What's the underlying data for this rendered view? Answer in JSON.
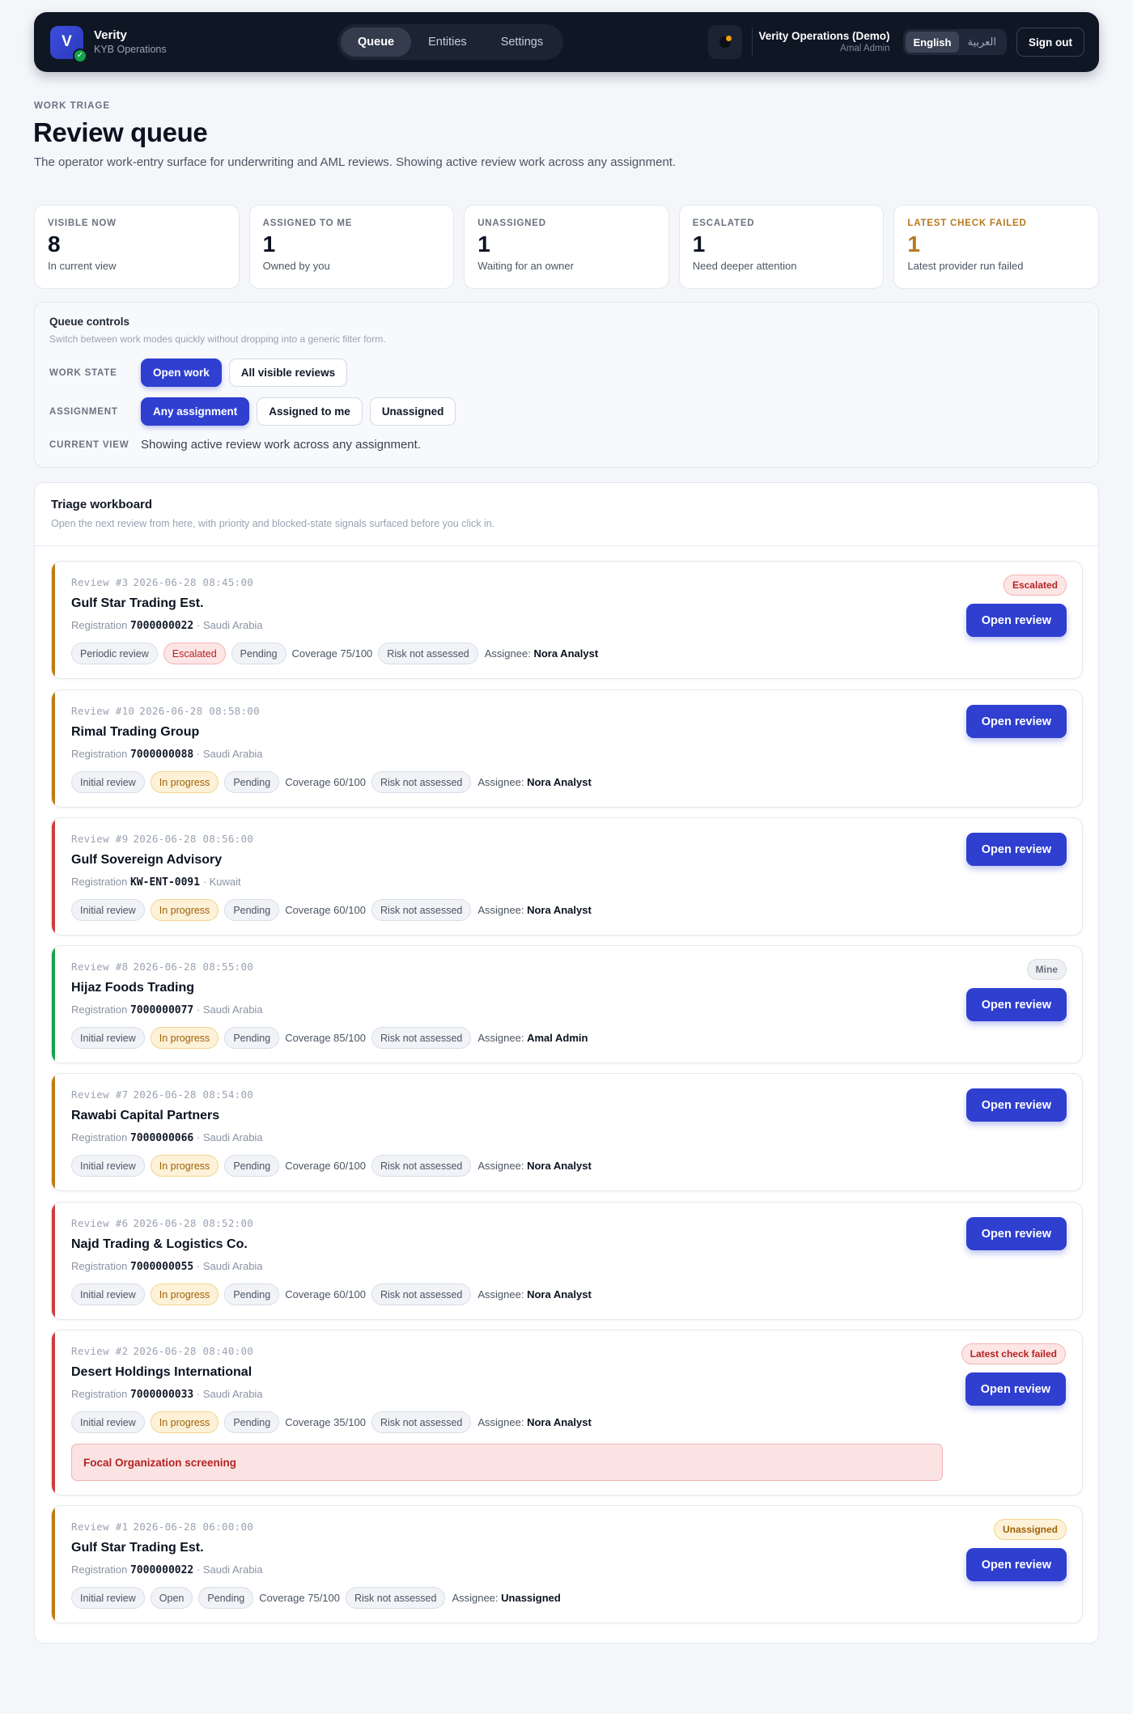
{
  "app": {
    "name": "Verity",
    "subtitle": "KYB Operations",
    "logo_letter": "V"
  },
  "nav": {
    "tabs": [
      {
        "label": "Queue",
        "active": true
      },
      {
        "label": "Entities",
        "active": false
      },
      {
        "label": "Settings",
        "active": false
      }
    ]
  },
  "account": {
    "org": "Verity Operations (Demo)",
    "user": "Amal Admin",
    "languages": [
      "English",
      "العربية"
    ],
    "active_language": "English",
    "signout_label": "Sign out"
  },
  "page": {
    "eyebrow": "WORK TRIAGE",
    "title": "Review queue",
    "description": "The operator work-entry surface for underwriting and AML reviews. Showing active review work across any assignment."
  },
  "stats": [
    {
      "label": "VISIBLE NOW",
      "value": "8",
      "note": "In current view"
    },
    {
      "label": "ASSIGNED TO ME",
      "value": "1",
      "note": "Owned by you"
    },
    {
      "label": "UNASSIGNED",
      "value": "1",
      "note": "Waiting for an owner"
    },
    {
      "label": "ESCALATED",
      "value": "1",
      "note": "Need deeper attention"
    },
    {
      "label": "LATEST CHECK FAILED",
      "value": "1",
      "note": "Latest provider run failed"
    }
  ],
  "controls": {
    "title": "Queue controls",
    "subtitle": "Switch between work modes quickly without dropping into a generic filter form.",
    "work_state_label": "WORK STATE",
    "work_state_options": [
      "Open work",
      "All visible reviews"
    ],
    "assignment_label": "ASSIGNMENT",
    "assignment_options": [
      "Any assignment",
      "Assigned to me",
      "Unassigned"
    ],
    "current_view_label": "CURRENT VIEW",
    "current_view": "Showing active review work across any assignment."
  },
  "board": {
    "title": "Triage workboard",
    "subtitle": "Open the next review from here, with priority and blocked-state signals surfaced before you click in.",
    "open_label": "Open review",
    "registration_label": "Registration",
    "assignee_label": "Assignee:",
    "reviews": [
      {
        "id": "Review #3",
        "time": "2026-06-28 08:45:00",
        "name": "Gulf Star Trading Est.",
        "reg": "7000000022",
        "country": "Saudi Arabia",
        "type": "Periodic review",
        "stage": "Escalated",
        "decision": "Pending",
        "coverage": "Coverage 75/100",
        "risk": "Risk not assessed",
        "assignee": "Nora Analyst",
        "badge": "Escalated",
        "accent": "#c27a12"
      },
      {
        "id": "Review #10",
        "time": "2026-06-28 08:58:00",
        "name": "Rimal Trading Group",
        "reg": "7000000088",
        "country": "Saudi Arabia",
        "type": "Initial review",
        "stage": "In progress",
        "decision": "Pending",
        "coverage": "Coverage 60/100",
        "risk": "Risk not assessed",
        "assignee": "Nora Analyst",
        "badge": "",
        "accent": "#c27a12"
      },
      {
        "id": "Review #9",
        "time": "2026-06-28 08:56:00",
        "name": "Gulf Sovereign Advisory",
        "reg": "KW-ENT-0091",
        "country": "Kuwait",
        "type": "Initial review",
        "stage": "In progress",
        "decision": "Pending",
        "coverage": "Coverage 60/100",
        "risk": "Risk not assessed",
        "assignee": "Nora Analyst",
        "badge": "",
        "accent": "#d23b3b"
      },
      {
        "id": "Review #8",
        "time": "2026-06-28 08:55:00",
        "name": "Hijaz Foods Trading",
        "reg": "7000000077",
        "country": "Saudi Arabia",
        "type": "Initial review",
        "stage": "In progress",
        "decision": "Pending",
        "coverage": "Coverage 85/100",
        "risk": "Risk not assessed",
        "assignee": "Amal Admin",
        "badge": "Mine",
        "accent": "#16a34a"
      },
      {
        "id": "Review #7",
        "time": "2026-06-28 08:54:00",
        "name": "Rawabi Capital Partners",
        "reg": "7000000066",
        "country": "Saudi Arabia",
        "type": "Initial review",
        "stage": "In progress",
        "decision": "Pending",
        "coverage": "Coverage 60/100",
        "risk": "Risk not assessed",
        "assignee": "Nora Analyst",
        "badge": "",
        "accent": "#c27a12"
      },
      {
        "id": "Review #6",
        "time": "2026-06-28 08:52:00",
        "name": "Najd Trading & Logistics Co.",
        "reg": "7000000055",
        "country": "Saudi Arabia",
        "type": "Initial review",
        "stage": "In progress",
        "decision": "Pending",
        "coverage": "Coverage 60/100",
        "risk": "Risk not assessed",
        "assignee": "Nora Analyst",
        "badge": "",
        "accent": "#d23b3b"
      },
      {
        "id": "Review #2",
        "time": "2026-06-28 08:40:00",
        "name": "Desert Holdings International",
        "reg": "7000000033",
        "country": "Saudi Arabia",
        "type": "Initial review",
        "stage": "In progress",
        "decision": "Pending",
        "coverage": "Coverage 35/100",
        "risk": "Risk not assessed",
        "assignee": "Nora Analyst",
        "badge": "Latest check failed",
        "alert": "Focal Organization screening",
        "accent": "#d23b3b"
      },
      {
        "id": "Review #1",
        "time": "2026-06-28 06:00:00",
        "name": "Gulf Star Trading Est.",
        "reg": "7000000022",
        "country": "Saudi Arabia",
        "type": "Initial review",
        "stage": "Open",
        "decision": "Pending",
        "coverage": "Coverage 75/100",
        "risk": "Risk not assessed",
        "assignee": "Unassigned",
        "badge": "Unassigned",
        "accent": "#c27a12"
      }
    ]
  }
}
